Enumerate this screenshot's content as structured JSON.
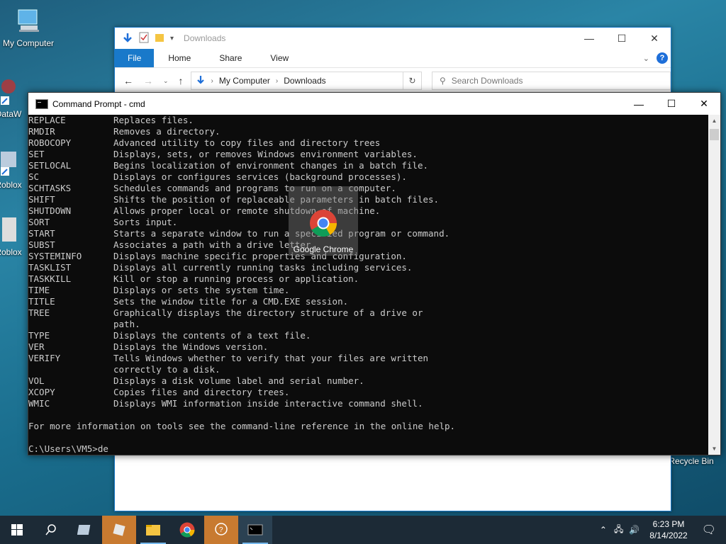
{
  "desktop": {
    "icons": [
      {
        "label": "My Computer"
      },
      {
        "label": "DataW"
      },
      {
        "label": "Roblox"
      },
      {
        "label": "Roblox"
      }
    ],
    "recycle_bin": "Recycle Bin"
  },
  "explorer": {
    "title": "Downloads",
    "ribbon_tabs": [
      "File",
      "Home",
      "Share",
      "View"
    ],
    "breadcrumb": [
      "My Computer",
      "Downloads"
    ],
    "search_placeholder": "Search Downloads",
    "help": "?"
  },
  "cmd": {
    "title": "Command Prompt - cmd",
    "commands": [
      {
        "name": "REPLACE",
        "desc": "Replaces files."
      },
      {
        "name": "RMDIR",
        "desc": "Removes a directory."
      },
      {
        "name": "ROBOCOPY",
        "desc": "Advanced utility to copy files and directory trees"
      },
      {
        "name": "SET",
        "desc": "Displays, sets, or removes Windows environment variables."
      },
      {
        "name": "SETLOCAL",
        "desc": "Begins localization of environment changes in a batch file."
      },
      {
        "name": "SC",
        "desc": "Displays or configures services (background processes)."
      },
      {
        "name": "SCHTASKS",
        "desc": "Schedules commands and programs to run on a computer."
      },
      {
        "name": "SHIFT",
        "desc": "Shifts the position of replaceable parameters in batch files."
      },
      {
        "name": "SHUTDOWN",
        "desc": "Allows proper local or remote shutdown of machine."
      },
      {
        "name": "SORT",
        "desc": "Sorts input."
      },
      {
        "name": "START",
        "desc": "Starts a separate window to run a specified program or command."
      },
      {
        "name": "SUBST",
        "desc": "Associates a path with a drive letter."
      },
      {
        "name": "SYSTEMINFO",
        "desc": "Displays machine specific properties and configuration."
      },
      {
        "name": "TASKLIST",
        "desc": "Displays all currently running tasks including services."
      },
      {
        "name": "TASKKILL",
        "desc": "Kill or stop a running process or application."
      },
      {
        "name": "TIME",
        "desc": "Displays or sets the system time."
      },
      {
        "name": "TITLE",
        "desc": "Sets the window title for a CMD.EXE session."
      },
      {
        "name": "TREE",
        "desc": "Graphically displays the directory structure of a drive or"
      },
      {
        "name": "",
        "desc": "path."
      },
      {
        "name": "TYPE",
        "desc": "Displays the contents of a text file."
      },
      {
        "name": "VER",
        "desc": "Displays the Windows version."
      },
      {
        "name": "VERIFY",
        "desc": "Tells Windows whether to verify that your files are written"
      },
      {
        "name": "",
        "desc": "correctly to a disk."
      },
      {
        "name": "VOL",
        "desc": "Displays a disk volume label and serial number."
      },
      {
        "name": "XCOPY",
        "desc": "Copies files and directory trees."
      },
      {
        "name": "WMIC",
        "desc": "Displays WMI information inside interactive command shell."
      }
    ],
    "footer": "For more information on tools see the command-line reference in the online help.",
    "prompt": "C:\\Users\\VM5>de"
  },
  "chrome_tile": {
    "label": "Google Chrome"
  },
  "taskbar": {
    "time": "6:23 PM",
    "date": "8/14/2022"
  }
}
